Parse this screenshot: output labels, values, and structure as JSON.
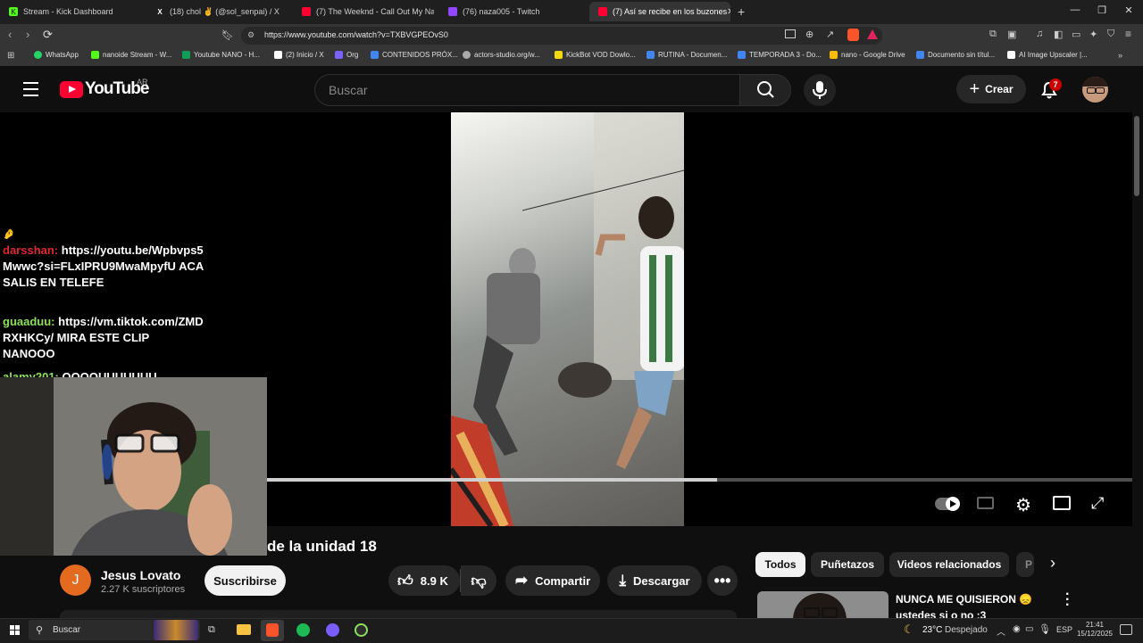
{
  "browser": {
    "tabs": [
      {
        "title": "Stream - Kick Dashboard",
        "color": "#53fc18"
      },
      {
        "title": "(18) chol ✌ (@sol_senpai) / X",
        "color": "#ffffff"
      },
      {
        "title": "(7) The Weeknd - Call Out My Name",
        "color": "#ff0033"
      },
      {
        "title": "(76) naza005 - Twitch",
        "color": "#9146ff"
      },
      {
        "title": "(7) Así se recibe en los buzones",
        "color": "#ff0033"
      }
    ],
    "new_tab": "+",
    "url": "https://www.youtube.com/watch?v=TXBVGPEOvS0",
    "bookmarks": [
      {
        "label": "WhatsApp",
        "color": "#25d366"
      },
      {
        "label": "nanoide Stream - W...",
        "color": "#53fc18"
      },
      {
        "label": "Youtube NANO - H...",
        "color": "#0f9d58"
      },
      {
        "label": "(2) Inicio / X",
        "color": "#ffffff"
      },
      {
        "label": "Org",
        "color": "#7b61ff"
      },
      {
        "label": "CONTENIDOS PRÓX...",
        "color": "#4285f4"
      },
      {
        "label": "actors-studio.org/w...",
        "color": "#aaaaaa"
      },
      {
        "label": "KickBot VOD Dowlo...",
        "color": "#f5d90a"
      },
      {
        "label": "RUTINA - Documen...",
        "color": "#4285f4"
      },
      {
        "label": "TEMPORADA 3 - Do...",
        "color": "#4285f4"
      },
      {
        "label": "nano - Google Drive",
        "color": "#fbbc04"
      },
      {
        "label": "Documento sin títul...",
        "color": "#4285f4"
      },
      {
        "label": "AI Image Upscaler |...",
        "color": "#ffffff"
      }
    ]
  },
  "youtube": {
    "logo_text": "YouTube",
    "region": "AR",
    "search_placeholder": "Buscar",
    "create_label": "Crear",
    "notification_count": "7"
  },
  "chat": [
    {
      "user": "darsshan:",
      "user_color": "#e0262f",
      "lines": [
        "https://youtu.be/Wpbvps5",
        "Mwwc?si=FLxIPRU9MwaMpyfU ACA",
        "SALIS EN TELEFE"
      ]
    },
    {
      "user": "guaaduu:",
      "user_color": "#8ce15a",
      "lines": [
        "https://vm.tiktok.com/ZMD",
        "RXHKCy/ MIRA ESTE CLIP",
        "NANOOO"
      ]
    },
    {
      "user": "alamy201:",
      "user_color": "#8ce15a",
      "lines": [
        "OOOOUUUUUUU"
      ]
    }
  ],
  "player": {
    "progress": 0.52
  },
  "video": {
    "title_visible": "de la unidad 18",
    "channel_initial": "J",
    "channel_name": "Jesus Lovato",
    "subscribers": "2.27 K suscriptores",
    "subscribe_label": "Suscribirse",
    "likes": "8.9 K",
    "share_label": "Compartir",
    "download_label": "Descargar"
  },
  "chips": [
    "Todos",
    "Puñetazos",
    "Videos relacionados",
    "P"
  ],
  "recommendation": {
    "title_line1": "NUNCA ME QUISIERON 😞",
    "title_line2": "ustedes si o no :3"
  },
  "taskbar": {
    "search_label": "Buscar",
    "weather": "23°C",
    "weather_desc": "Despejado",
    "language": "ESP",
    "time": "21:41",
    "date": "15/12/2025"
  }
}
